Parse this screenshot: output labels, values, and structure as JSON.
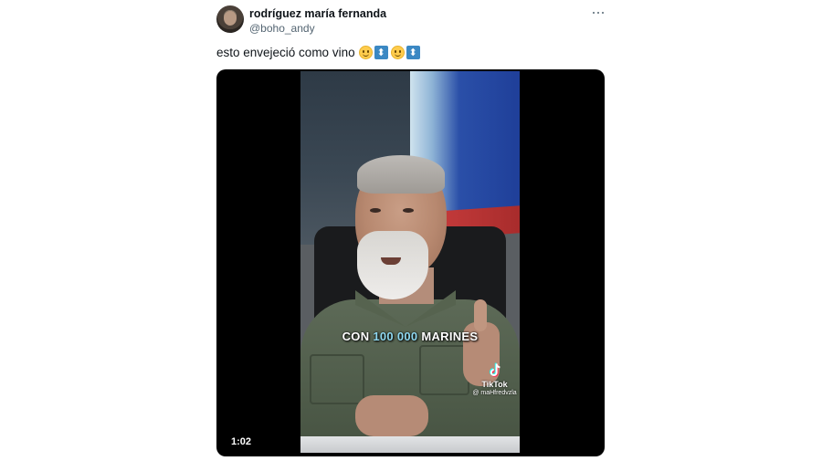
{
  "author": {
    "display_name": "rodríguez maría fernanda",
    "handle": "@boho_andy"
  },
  "tweet": {
    "text": "esto envejeció como vino",
    "emojis": [
      "slightly-smiling-face-icon",
      "up-down-arrow-icon",
      "slightly-smiling-face-icon",
      "up-down-arrow-icon"
    ]
  },
  "video": {
    "caption_prefix": "CON ",
    "caption_highlight": "100 000",
    "caption_suffix": " MARINES",
    "watermark_label": "TikTok",
    "watermark_user": "@ maHfredvzla",
    "duration": "1:02"
  },
  "colors": {
    "text_primary": "#0f1419",
    "text_secondary": "#536471",
    "media_bg": "#000000",
    "caption_highlight": "#8fd8f0"
  }
}
